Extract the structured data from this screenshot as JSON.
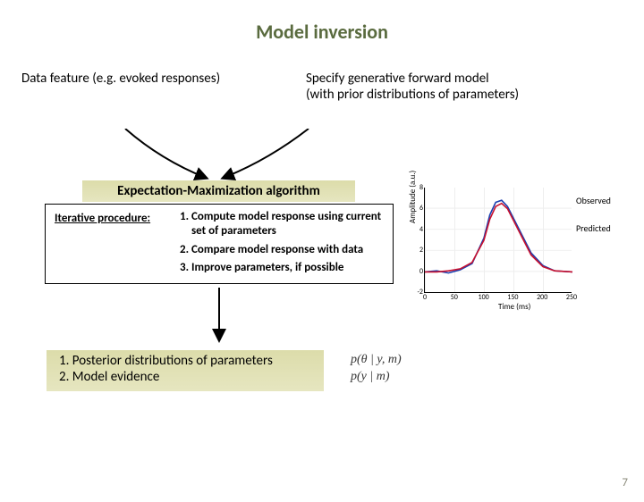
{
  "title": "Model inversion",
  "top": {
    "left": "Data feature (e.g. evoked responses)",
    "right_l1": "Specify generative forward model",
    "right_l2": "(with prior distributions of parameters)"
  },
  "em_label": "Expectation-Maximization algorithm",
  "procedure": {
    "heading": "Iterative procedure:",
    "steps": [
      "Compute model response using current set of parameters",
      "Compare model response with data",
      "Improve parameters, if possible"
    ]
  },
  "outputs": {
    "items": [
      "Posterior distributions of parameters",
      "Model evidence"
    ]
  },
  "formulas": {
    "f1": "p(θ | y, m)",
    "f2": "p(y | m)"
  },
  "page": "7",
  "chart_data": {
    "type": "line",
    "xlabel": "Time (ms)",
    "ylabel": "Amplitude (a.u.)",
    "x_ticks": [
      0,
      50,
      100,
      150,
      200,
      250
    ],
    "y_ticks": [
      -2,
      0,
      2,
      4,
      6,
      8
    ],
    "xlim": [
      0,
      250
    ],
    "ylim": [
      -2,
      8
    ],
    "series": [
      {
        "name": "Observed",
        "color": "#1a3fb0",
        "x": [
          0,
          20,
          40,
          60,
          80,
          100,
          110,
          120,
          130,
          140,
          160,
          180,
          200,
          220,
          250
        ],
        "y": [
          0,
          0.1,
          -0.1,
          0.2,
          0.8,
          3.2,
          5.4,
          6.6,
          6.8,
          6.2,
          4.0,
          1.8,
          0.6,
          0.1,
          0
        ]
      },
      {
        "name": "Predicted",
        "color": "#c8102e",
        "x": [
          0,
          20,
          40,
          60,
          80,
          100,
          110,
          120,
          130,
          140,
          160,
          180,
          200,
          220,
          250
        ],
        "y": [
          0,
          0,
          0.1,
          0.3,
          0.9,
          3.0,
          5.0,
          6.2,
          6.5,
          6.0,
          3.8,
          1.6,
          0.5,
          0.1,
          0
        ]
      }
    ],
    "legend": [
      "Observed",
      "Predicted"
    ]
  }
}
